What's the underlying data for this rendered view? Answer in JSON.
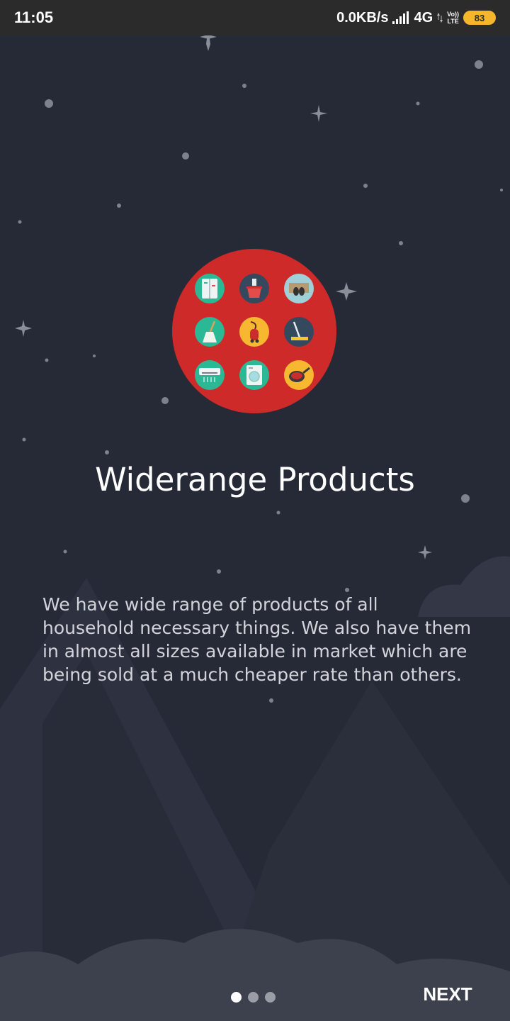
{
  "status_bar": {
    "time": "11:05",
    "network_speed": "0.0KB/s",
    "network_type": "4G",
    "volte_top": "Vo))",
    "volte_bottom": "LTE",
    "battery": "83",
    "icons": [
      "signal-icon",
      "data-arrows-icon",
      "volte-icon",
      "battery-icon"
    ]
  },
  "onboarding": {
    "title": "Widerange Products",
    "description": "We have wide range of products of all household necessary things. We also have them in almost all sizes available in market which are being sold at a much cheaper rate than others.",
    "hero_icons": [
      "fridge-icon",
      "cleaning-bucket-icon",
      "doormat-icon",
      "broom-icon",
      "vacuum-cleaner-icon",
      "mop-icon",
      "air-conditioner-icon",
      "washing-machine-icon",
      "frying-pan-icon"
    ],
    "pager": {
      "total": 3,
      "current": 1
    },
    "next_label": "NEXT"
  },
  "colors": {
    "background": "#262a37",
    "hero_circle": "#ce2a2a",
    "teal": "#2bb894",
    "navy": "#34495e",
    "yellow": "#f7b731",
    "light_blue": "#9fd0d7"
  }
}
